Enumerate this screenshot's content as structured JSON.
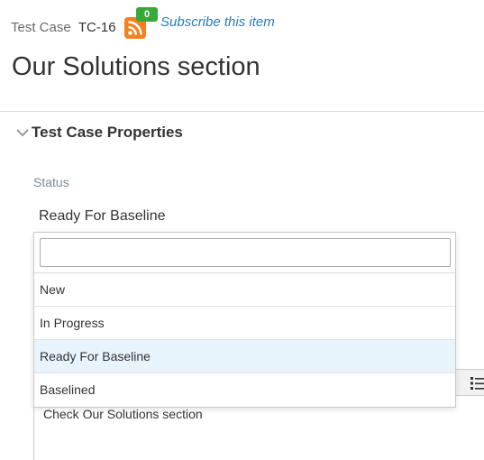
{
  "header": {
    "item_type": "Test Case",
    "item_id": "TC-16",
    "subscriber_count": "0",
    "subscribe_label": "Subscribe this item",
    "title": "Our Solutions section"
  },
  "section": {
    "title": "Test Case Properties"
  },
  "status_field": {
    "label": "Status",
    "value": "Ready For Baseline"
  },
  "dropdown": {
    "search_value": "",
    "options": [
      {
        "label": "New",
        "selected": false
      },
      {
        "label": "In Progress",
        "selected": false
      },
      {
        "label": "Ready For Baseline",
        "selected": true
      },
      {
        "label": "Baselined",
        "selected": false
      }
    ]
  },
  "editor": {
    "content": "Check Our Solutions section"
  },
  "colors": {
    "link": "#2a7ab8",
    "rss": "#f4811f",
    "badge": "#37a93a",
    "selected_option": "#e8f4fb"
  },
  "icons": {
    "rss": "rss-feed-icon",
    "collapse": "chevron-down-icon",
    "list": "bulleted-list-icon"
  }
}
